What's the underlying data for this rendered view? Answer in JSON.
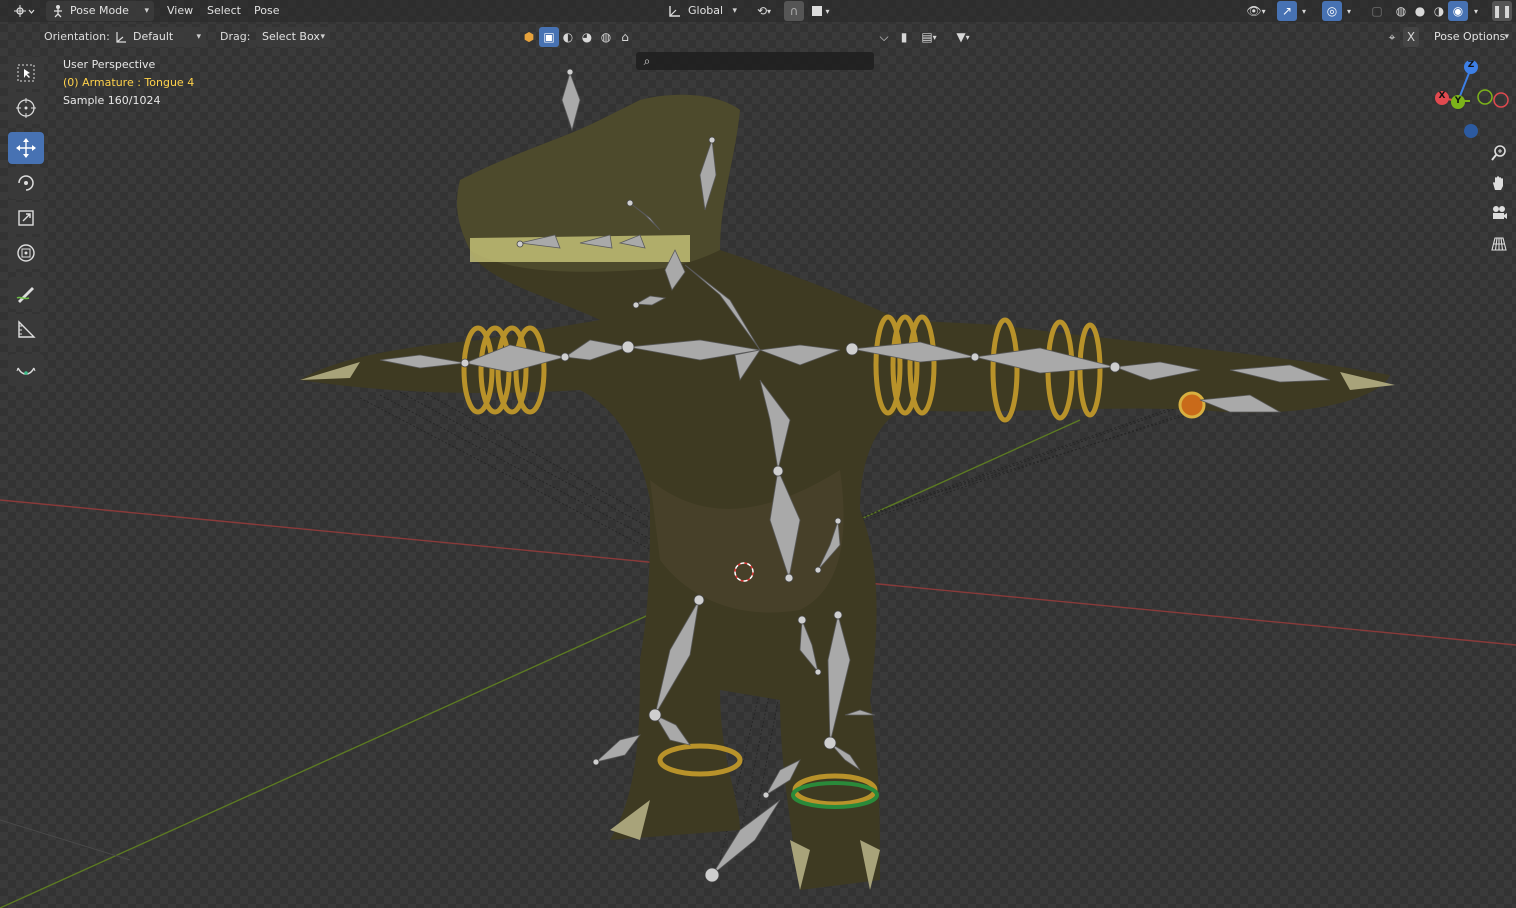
{
  "header": {
    "editor_icon": "3d-viewport-icon",
    "mode": "Pose Mode",
    "menus": [
      "View",
      "Select",
      "Pose"
    ],
    "transform_orientation": "Global"
  },
  "tool_settings": {
    "orientation_label": "Orientation:",
    "orientation_value": "Default",
    "drag_label": "Drag:",
    "drag_value": "Select Box",
    "pose_options": "Pose Options",
    "x_label": "X"
  },
  "overlay": {
    "view_name": "User Perspective",
    "active_object": "(0) Armature : Tongue 4",
    "sample": "Sample 160/1024"
  },
  "navigation_gizmo": {
    "x_label": "X",
    "y_label": "Y",
    "z_label": "Z"
  },
  "toolbar": {
    "tools": [
      "select-box-icon",
      "cursor-icon",
      "move-icon",
      "rotate-icon",
      "scale-icon",
      "transform-icon",
      "annotate-icon",
      "measure-icon",
      "roll-icon"
    ],
    "active_tool": "move-icon"
  },
  "colors": {
    "accent": "#4772b3",
    "active_text": "#ffd24a",
    "x_axis": "#e0494f",
    "y_axis": "#7cb31a",
    "z_axis": "#3d7fe6"
  }
}
